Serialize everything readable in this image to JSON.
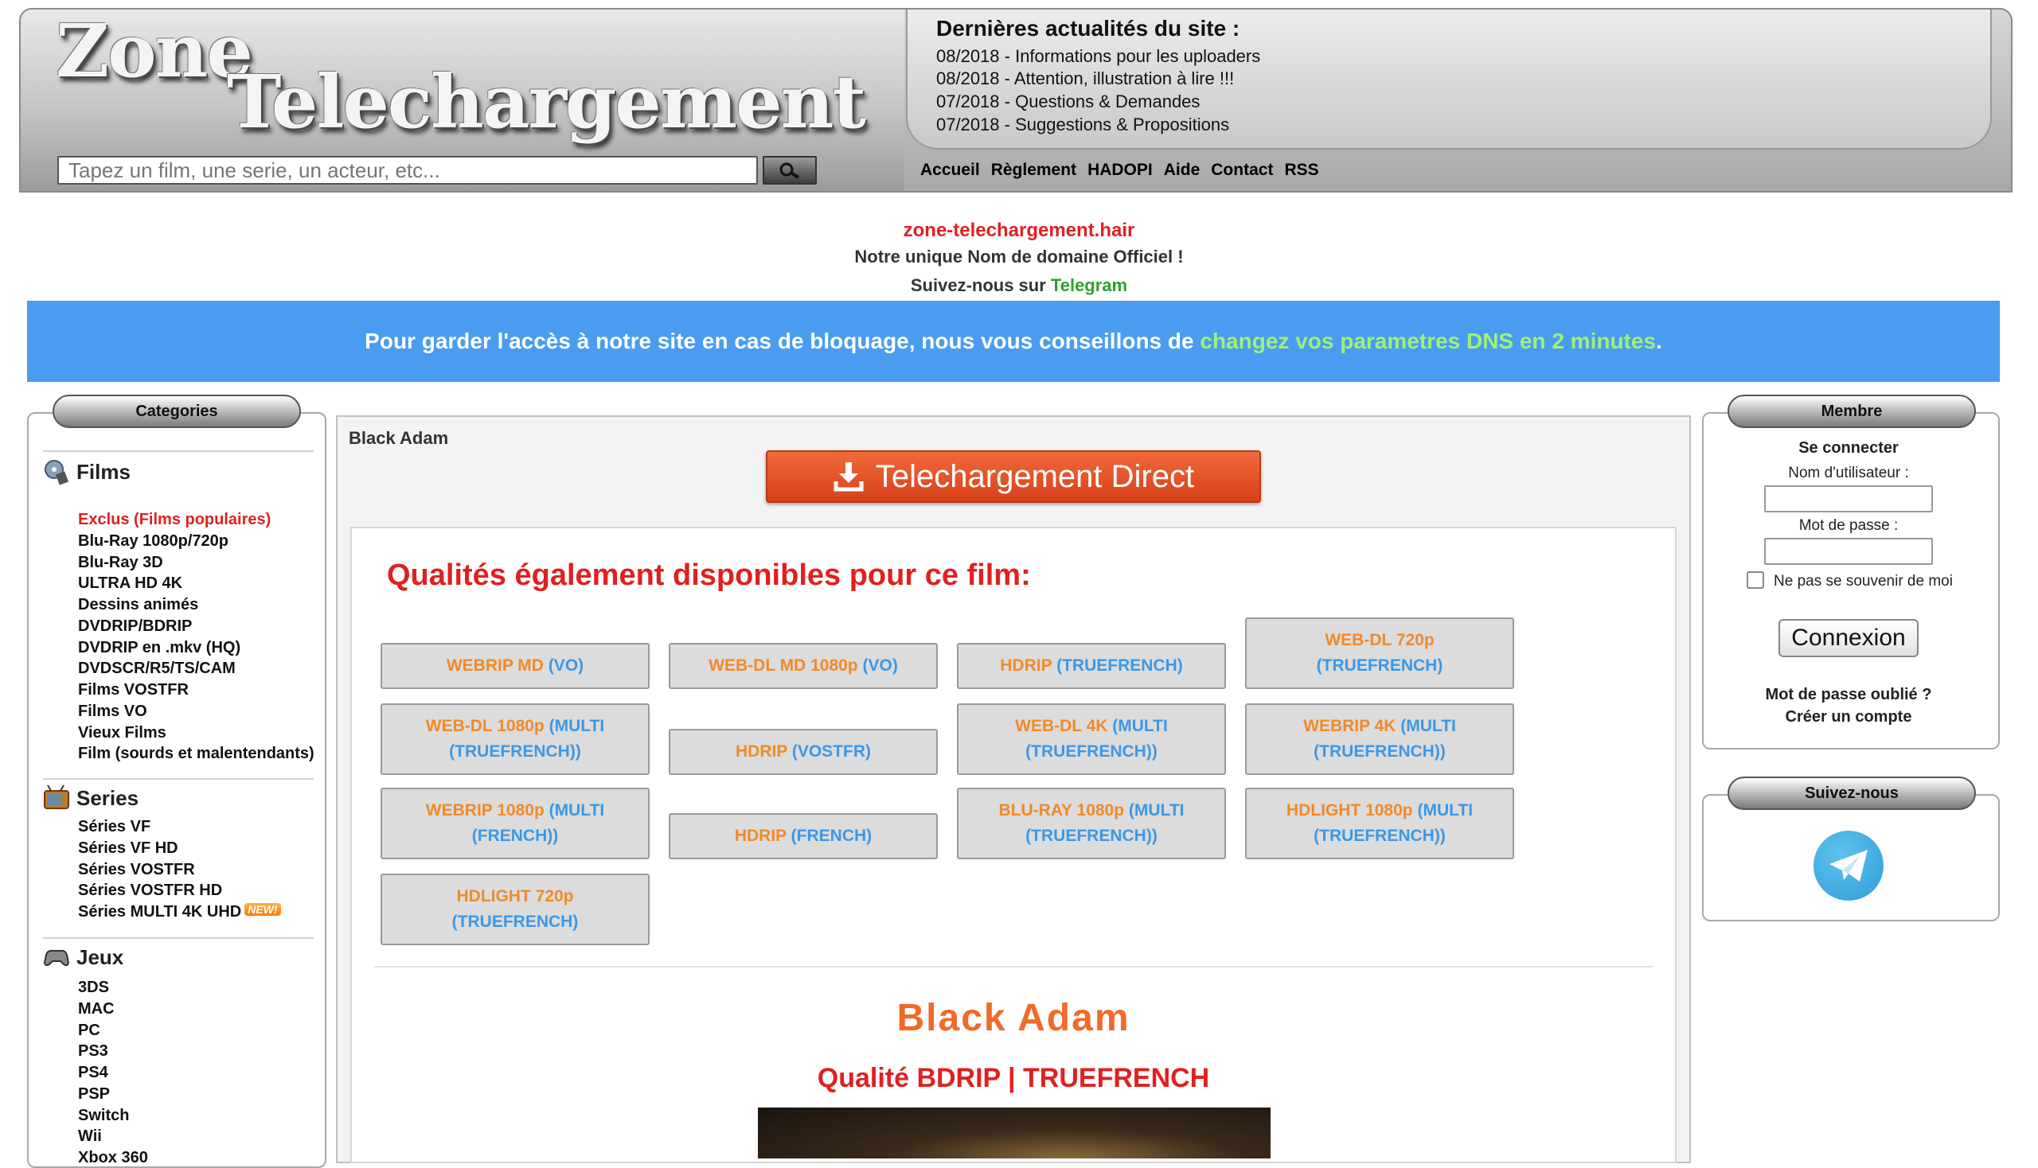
{
  "header": {
    "logo_line1": "Zone",
    "logo_line2": "Telechargement",
    "search_placeholder": "Tapez un film, une serie, un acteur, etc...",
    "news_title": "Dernières actualités du site :",
    "news": [
      "08/2018 - Informations pour les uploaders",
      "08/2018 - Attention, illustration à lire !!!",
      "07/2018 - Questions & Demandes",
      "07/2018 - Suggestions & Propositions"
    ],
    "nav": [
      "Accueil",
      "Règlement",
      "HADOPI",
      "Aide",
      "Contact",
      "RSS"
    ]
  },
  "notice": {
    "domain": "zone-telechargement.hair",
    "line2": "Notre unique Nom de domaine Officiel !",
    "line3_prefix": "Suivez-nous sur ",
    "line3_link": "Telegram",
    "banner_text": "Pour garder l'accès à notre site en cas de bloquage, nous vous conseillons de ",
    "banner_link": "changez vos parametres DNS en 2 minutes",
    "banner_end": "."
  },
  "sidebar": {
    "title": "Categories",
    "films_label": "Films",
    "films": [
      "Exclus (Films populaires)",
      "Blu-Ray 1080p/720p",
      "Blu-Ray 3D",
      "ULTRA HD 4K",
      "Dessins animés",
      "DVDRIP/BDRIP",
      "DVDRIP en .mkv (HQ)",
      "DVDSCR/R5/TS/CAM",
      "Films VOSTFR",
      "Films VO",
      "Vieux Films",
      "Film (sourds et malentendants)"
    ],
    "series_label": "Series",
    "series": [
      "Séries VF",
      "Séries VF HD",
      "Séries VOSTFR",
      "Séries VOSTFR HD",
      "Séries MULTI 4K UHD"
    ],
    "new_badge": "NEW!",
    "games_label": "Jeux",
    "games": [
      "3DS",
      "MAC",
      "PC",
      "PS3",
      "PS4",
      "PSP",
      "Switch",
      "Wii",
      "Xbox 360"
    ]
  },
  "main": {
    "breadcrumb": "Black Adam",
    "download_label": "Telechargement Direct",
    "qualities_title": "Qualités également disponibles pour ce film:",
    "qualities": [
      {
        "q": "WEBRIP MD",
        "lang": "(VO)"
      },
      {
        "q": "WEB-DL MD 1080p",
        "lang": "(VO)"
      },
      {
        "q": "HDRIP",
        "lang": "(TRUEFRENCH)"
      },
      {
        "q": "WEB-DL 720p",
        "lang": "(TRUEFRENCH)"
      },
      {
        "q": "WEB-DL 1080p",
        "lang": "(MULTI (TRUEFRENCH))"
      },
      {
        "q": "HDRIP",
        "lang": "(VOSTFR)"
      },
      {
        "q": "WEB-DL 4K",
        "lang": "(MULTI (TRUEFRENCH))"
      },
      {
        "q": "WEBRIP 4K",
        "lang": "(MULTI (TRUEFRENCH))"
      },
      {
        "q": "WEBRIP 1080p",
        "lang": "(MULTI (FRENCH))"
      },
      {
        "q": "HDRIP",
        "lang": "(FRENCH)"
      },
      {
        "q": "BLU-RAY 1080p",
        "lang": "(MULTI (TRUEFRENCH))"
      },
      {
        "q": "HDLIGHT 1080p",
        "lang": "(MULTI (TRUEFRENCH))"
      },
      {
        "q": "HDLIGHT 720p",
        "lang": "(TRUEFRENCH)"
      }
    ],
    "movie_title": "Black Adam",
    "movie_quality": "Qualité BDRIP | TRUEFRENCH"
  },
  "member": {
    "title": "Membre",
    "login_heading": "Se connecter",
    "username_label": "Nom d'utilisateur :",
    "password_label": "Mot de passe :",
    "remember_label": "Ne pas se souvenir de moi",
    "login_button": "Connexion",
    "forgot_link": "Mot de passe oublié ?",
    "register_link": "Créer un compte"
  },
  "follow": {
    "title": "Suivez-nous"
  }
}
